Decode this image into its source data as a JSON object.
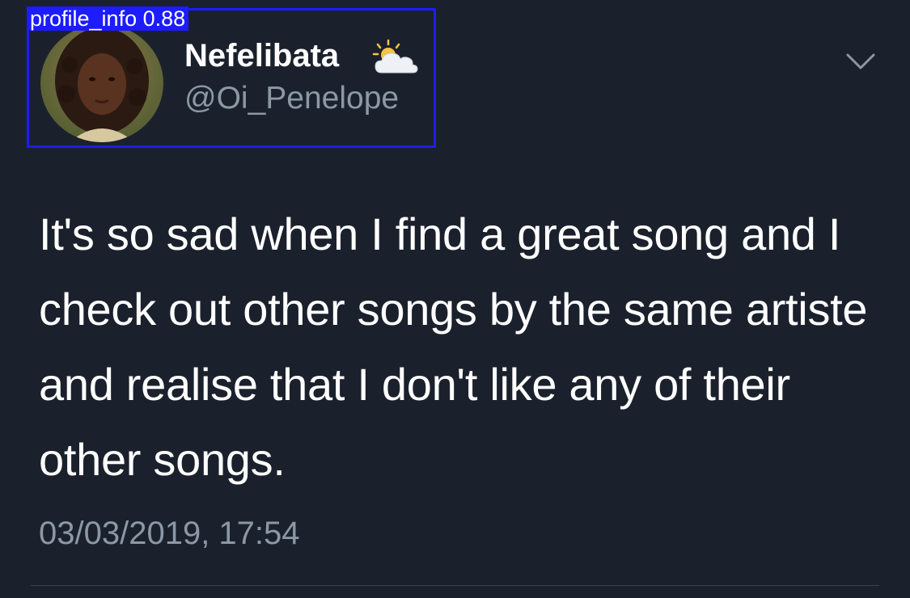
{
  "detection": {
    "label": "profile_info  0.88"
  },
  "profile": {
    "display_name": "Nefelibata",
    "handle": "@Oi_Penelope",
    "name_emoji": "sun-behind-cloud-icon",
    "avatar": "avatar"
  },
  "header": {
    "menu_icon": "chevron-down-icon"
  },
  "tweet": {
    "text": "It's so sad when I find a great song and I check out other songs by the same artiste and realise that I don't like any of their other songs.",
    "timestamp": "03/03/2019, 17:54"
  },
  "colors": {
    "background": "#1b212c",
    "primary_text": "#ffffff",
    "secondary_text": "#8b98a5",
    "detection_box": "#1c1cff",
    "divider": "#38444d"
  }
}
